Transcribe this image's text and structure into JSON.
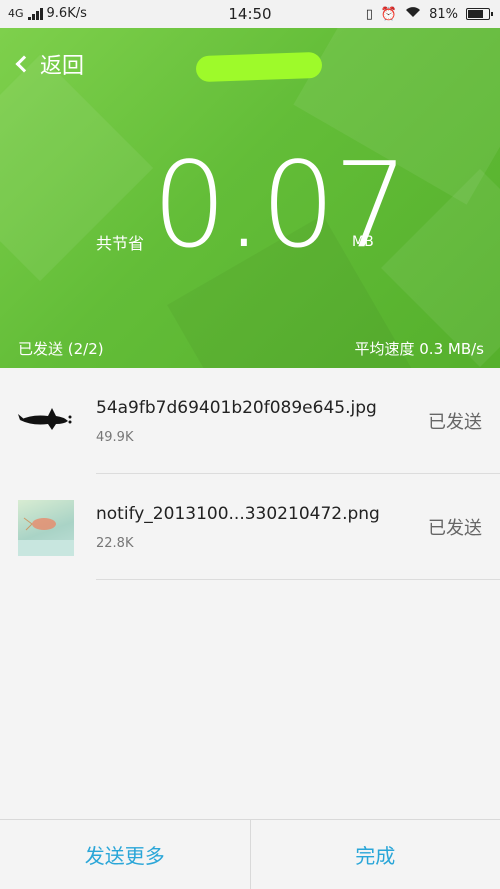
{
  "status_bar": {
    "network": "4G",
    "speed": "9.6K/s",
    "time": "14:50",
    "battery": "81%",
    "battery_fraction": 0.81,
    "icons": [
      "vibrate-icon",
      "alarm-icon",
      "wifi-icon",
      "battery-icon"
    ]
  },
  "header": {
    "back_label": "返回"
  },
  "summary": {
    "saved_label": "共节省",
    "saved_value": "0.07",
    "saved_unit": "MB",
    "sent_status": "已发送 (2/2)",
    "avg_speed": "平均速度 0.3 MB/s"
  },
  "files": [
    {
      "name": "54a9fb7d69401b20f089e645.jpg",
      "size": "49.9K",
      "status": "已发送"
    },
    {
      "name": "notify_2013100...330210472.png",
      "size": "22.8K",
      "status": "已发送"
    }
  ],
  "footer": {
    "send_more": "发送更多",
    "done": "完成"
  },
  "colors": {
    "accent_green": "#63bd38",
    "action_blue": "#2aa6d8"
  }
}
